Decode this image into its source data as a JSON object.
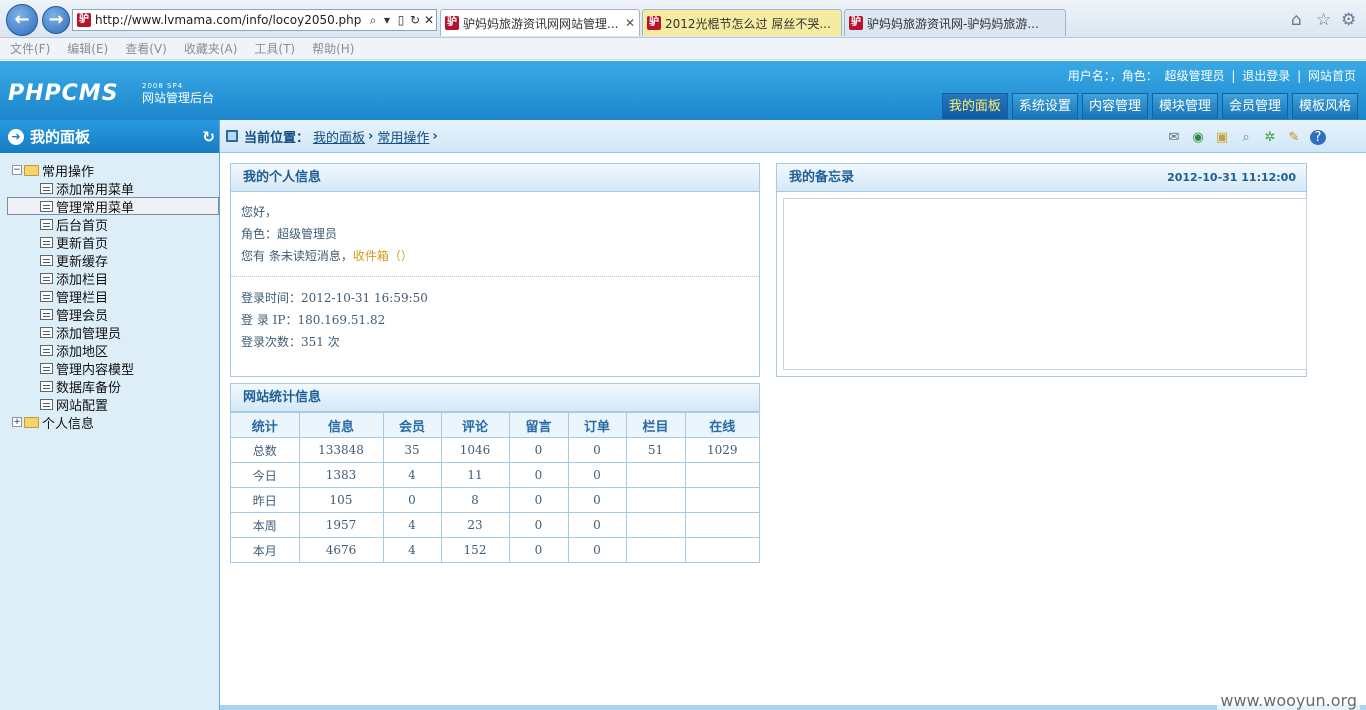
{
  "browser": {
    "url": "http://www.lvmama.com/info/locoy2050.php",
    "tabs": [
      {
        "title": "驴妈妈旅游资讯网网站管理..."
      },
      {
        "title": "2012光棍节怎么过 屌丝不哭..."
      },
      {
        "title": "驴妈妈旅游资讯网-驴妈妈旅游..."
      }
    ],
    "menu": [
      "文件(F)",
      "编辑(E)",
      "查看(V)",
      "收藏夹(A)",
      "工具(T)",
      "帮助(H)"
    ]
  },
  "header": {
    "logo": "PHPCMS",
    "logo_sub": "2008 SP4",
    "logo_tag": "网站管理后台",
    "user_label": "用户名：，角色：",
    "role": "超级管理员",
    "logout": "退出登录",
    "home": "网站首页",
    "nav": [
      "我的面板",
      "系统设置",
      "内容管理",
      "模块管理",
      "会员管理",
      "模板风格"
    ]
  },
  "sidebar": {
    "title": "我的面板",
    "groups": [
      {
        "label": "常用操作",
        "items": [
          "添加常用菜单",
          "管理常用菜单",
          "后台首页",
          "更新首页",
          "更新缓存",
          "添加栏目",
          "管理栏目",
          "管理会员",
          "添加管理员",
          "添加地区",
          "管理内容模型",
          "数据库备份",
          "网站配置"
        ]
      },
      {
        "label": "个人信息"
      }
    ]
  },
  "breadcrumb": {
    "prefix": "当前位置：",
    "items": [
      "我的面板",
      "常用操作"
    ]
  },
  "info_panel": {
    "title": "我的个人信息",
    "greeting": "您好，",
    "role_line": "角色：超级管理员",
    "msg_prefix": "您有 条未读短消息，",
    "inbox": "收件箱（）",
    "login_time": "登录时间：2012-10-31 16:59:50",
    "login_ip": "登 录 IP：180.169.51.82",
    "login_count": "登录次数：351 次"
  },
  "memo_panel": {
    "title": "我的备忘录",
    "datetime": "2012-10-31  11:12:00"
  },
  "stats": {
    "title": "网站统计信息",
    "headers": [
      "统计",
      "信息",
      "会员",
      "评论",
      "留言",
      "订单",
      "栏目",
      "在线"
    ],
    "rows": [
      [
        "总数",
        "133848",
        "35",
        "1046",
        "0",
        "0",
        "51",
        "1029"
      ],
      [
        "今日",
        "1383",
        "4",
        "11",
        "0",
        "0",
        "",
        ""
      ],
      [
        "昨日",
        "105",
        "0",
        "8",
        "0",
        "0",
        "",
        ""
      ],
      [
        "本周",
        "1957",
        "4",
        "23",
        "0",
        "0",
        "",
        ""
      ],
      [
        "本月",
        "4676",
        "4",
        "152",
        "0",
        "0",
        "",
        ""
      ]
    ]
  },
  "watermark": "www.wooyun.org"
}
